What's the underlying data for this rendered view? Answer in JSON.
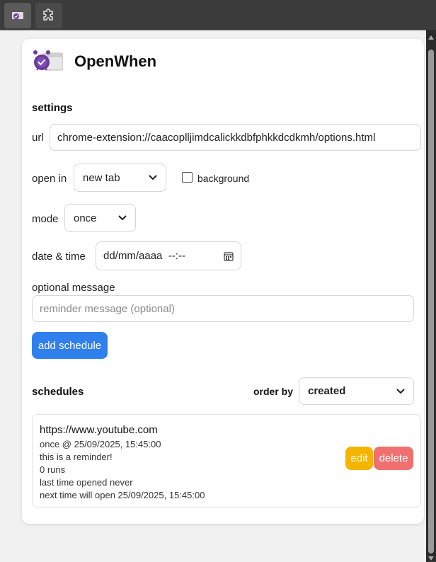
{
  "app": {
    "title": "OpenWhen"
  },
  "settings": {
    "title": "settings",
    "url_label": "url",
    "url_value": "chrome-extension://caacoplljimdcalickkdbfphkkdcdkmh/options.html",
    "open_in_label": "open in",
    "open_in_value": "new tab",
    "background_label": "background",
    "background_checked": false,
    "mode_label": "mode",
    "mode_value": "once",
    "datetime_label": "date & time",
    "datetime_value": "dd/mm/aaaa  --:--",
    "message_label": "optional message",
    "message_placeholder": "reminder message (optional)",
    "add_button": "add schedule"
  },
  "schedules": {
    "title": "schedules",
    "order_by_label": "order by",
    "order_by_value": "created",
    "items": [
      {
        "url": "https://www.youtube.com",
        "when": "once @ 25/09/2025, 15:45:00",
        "message": "this is a reminder!",
        "runs": "0 runs",
        "last_opened": "last time opened never",
        "next_open": "next time will open 25/09/2025, 15:45:00",
        "edit_label": "edit",
        "delete_label": "delete"
      }
    ]
  },
  "icons": {
    "active_extension": "alarm-extension-icon",
    "extensions": "puzzle-icon",
    "logo": "alarm-clock-logo-icon",
    "calendar": "calendar-icon",
    "chevron": "chevron-down-icon"
  },
  "colors": {
    "primary": "#2f80ed",
    "edit": "#f5b400",
    "delete": "#f07070",
    "logo_purple": "#6a3a9a"
  }
}
